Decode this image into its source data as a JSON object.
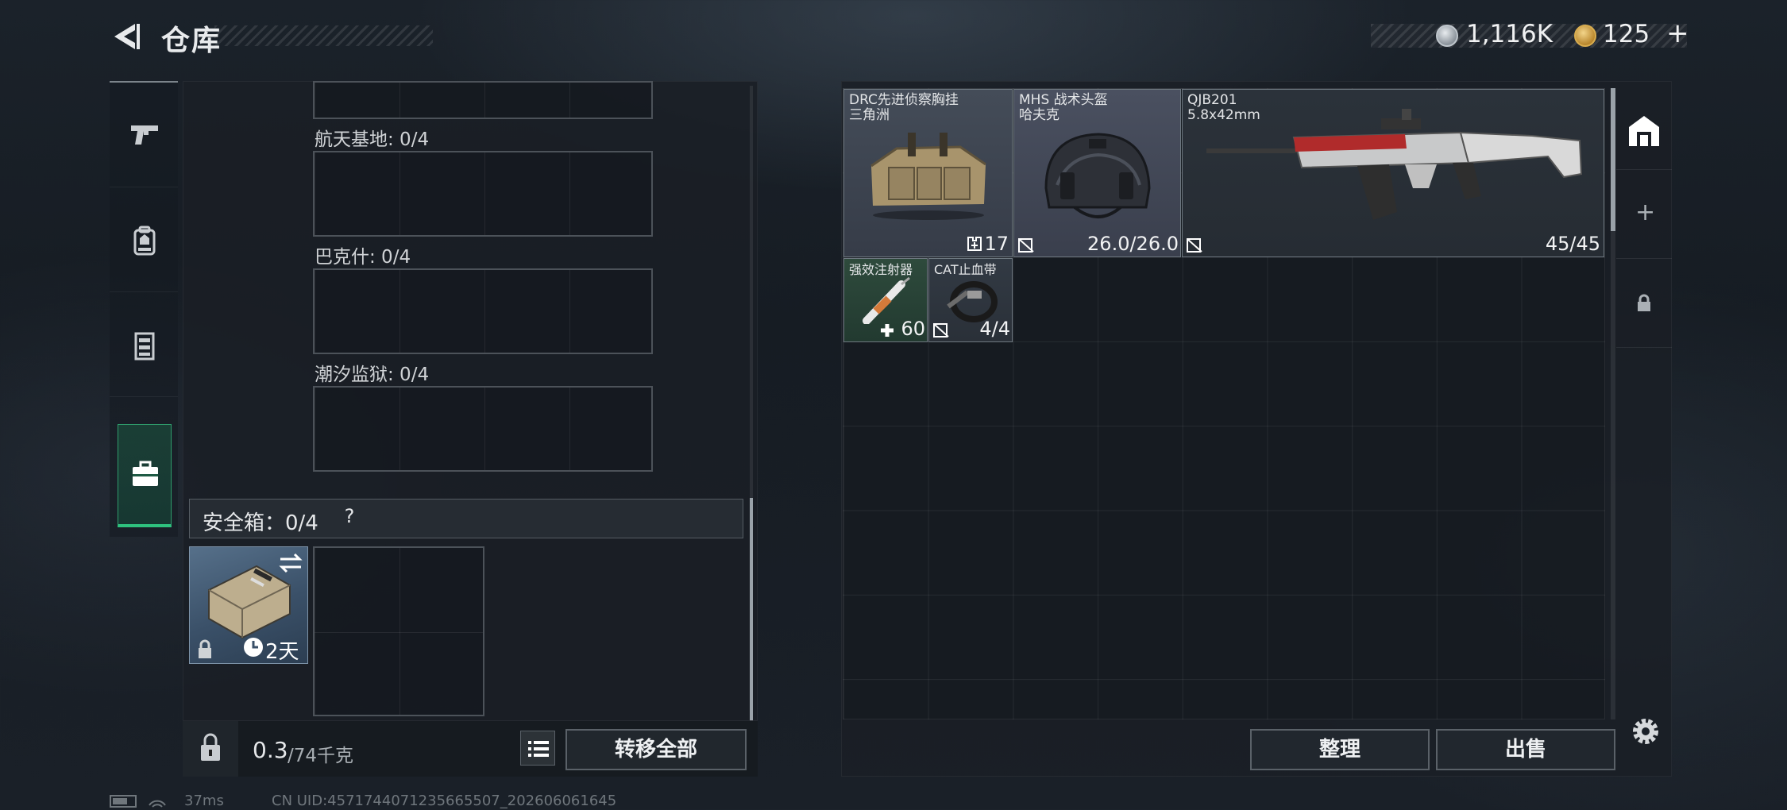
{
  "header": {
    "title": "仓库",
    "currency1": "1,116K",
    "currency2": "125",
    "plus": "+"
  },
  "left_nav": {
    "items": [
      {
        "icon": "pistol-icon"
      },
      {
        "icon": "backpack-icon"
      },
      {
        "icon": "chest-rig-icon"
      },
      {
        "icon": "case-icon",
        "active": true
      }
    ]
  },
  "maps": [
    {
      "label": "航天基地: 0/4"
    },
    {
      "label": "巴克什: 0/4"
    },
    {
      "label": "潮汐监狱: 0/4"
    }
  ],
  "safebox": {
    "label": "安全箱：0/4",
    "help": "?",
    "time": "2天"
  },
  "weight": {
    "current": "0.3",
    "max": "/74千克"
  },
  "buttons": {
    "transfer_all": "转移全部",
    "sort": "整理",
    "sell": "出售"
  },
  "items": [
    {
      "name_line1": "DRC先进侦察胸挂",
      "name_line2": "三角洲",
      "value": "17"
    },
    {
      "name_line1": "MHS 战术头盔",
      "name_line2": "哈夫克",
      "value": "26.0/26.0"
    },
    {
      "name_line1": "QJB201",
      "name_line2": "5.8x42mm",
      "value": "45/45"
    },
    {
      "name_line1": "强效注射器",
      "value": "60"
    },
    {
      "name_line1": "CAT止血带",
      "value": "4/4"
    }
  ],
  "right_nav": {
    "items": [
      {
        "icon": "storage-icon"
      },
      {
        "icon": "add-icon",
        "label": "+"
      },
      {
        "icon": "lock-icon"
      }
    ]
  },
  "status": {
    "ping": "37ms",
    "uid": "CN UID:4571744071235665507_202606061645"
  },
  "colors": {
    "accent_green": "#2ec27e",
    "panel_bg": "#1a1f25",
    "border": "#5a6168"
  }
}
